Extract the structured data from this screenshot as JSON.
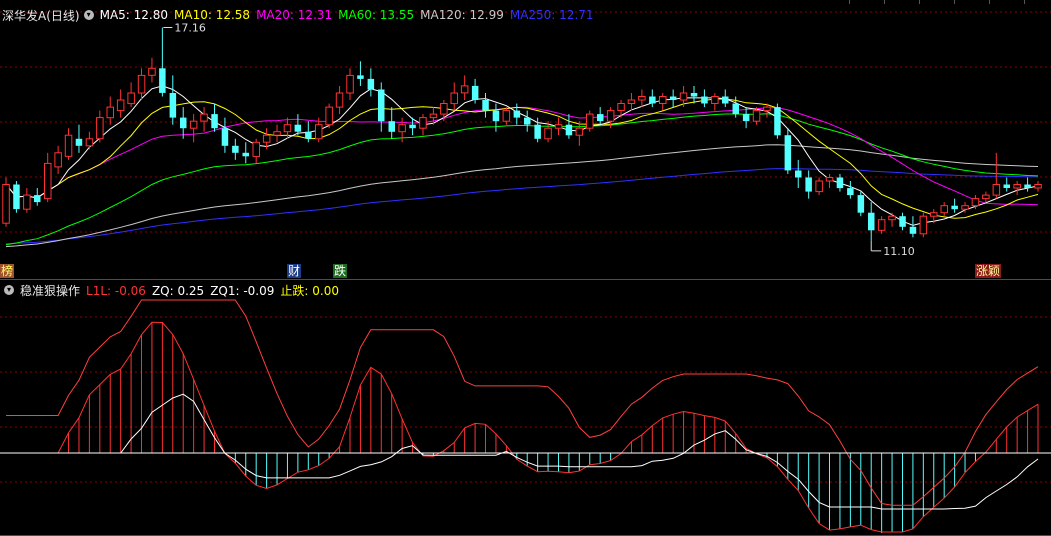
{
  "header": {
    "stock_name": "深华发A",
    "period": "(日线)",
    "ma": [
      {
        "label": "MA5: 12.80",
        "color": "#ffffff"
      },
      {
        "label": "MA10: 12.58",
        "color": "#ffff00"
      },
      {
        "label": "MA20: 12.31",
        "color": "#ff00ff"
      },
      {
        "label": "MA60: 13.55",
        "color": "#00ff00"
      },
      {
        "label": "MA120: 12.99",
        "color": "#c8c8c8"
      },
      {
        "label": "MA250: 12.71",
        "color": "#3030ff"
      }
    ]
  },
  "price_panel": {
    "high_label": "17.16",
    "low_label": "11.10",
    "tags": [
      {
        "text": "榜",
        "bg": "#a0522d",
        "color": "#ffff66"
      },
      {
        "text": "财",
        "bg": "#1e3a8a",
        "color": "#ffffff"
      },
      {
        "text": "跌",
        "bg": "#1f6b1f",
        "color": "#ffffff"
      },
      {
        "text": "涨颖",
        "bg": "#8b1a1a",
        "color": "#ffff99"
      }
    ]
  },
  "indicator": {
    "name": "稳准狠操作",
    "values": [
      {
        "label": "L1L: -0.06",
        "color": "#ff3333"
      },
      {
        "label": "ZQ: 0.25",
        "color": "#ffffff"
      },
      {
        "label": "ZQ1: -0.09",
        "color": "#ffffff"
      },
      {
        "label": "止跌: 0.00",
        "color": "#ffff00"
      }
    ]
  },
  "colors": {
    "up": "#ff3232",
    "down": "#54ffff",
    "grid": "#8b0000",
    "divider": "#b22222"
  },
  "candles": [
    [
      11.6,
      12.9,
      11.5,
      12.7
    ],
    [
      12.7,
      12.8,
      11.9,
      12.0
    ],
    [
      12.0,
      12.6,
      11.9,
      12.4
    ],
    [
      12.4,
      12.6,
      12.1,
      12.2
    ],
    [
      12.3,
      13.6,
      12.2,
      13.3
    ],
    [
      13.2,
      13.8,
      13.0,
      13.6
    ],
    [
      13.5,
      14.3,
      13.4,
      14.1
    ],
    [
      14.0,
      14.4,
      13.6,
      13.8
    ],
    [
      13.8,
      14.2,
      13.7,
      14.0
    ],
    [
      14.0,
      14.8,
      13.9,
      14.6
    ],
    [
      14.6,
      15.2,
      14.4,
      14.9
    ],
    [
      14.8,
      15.4,
      14.6,
      15.1
    ],
    [
      15.0,
      15.6,
      14.9,
      15.3
    ],
    [
      15.3,
      16.0,
      15.1,
      15.8
    ],
    [
      15.8,
      16.3,
      15.6,
      16.0
    ],
    [
      16.0,
      17.16,
      15.2,
      15.3
    ],
    [
      15.3,
      15.8,
      14.4,
      14.6
    ],
    [
      14.6,
      14.9,
      14.0,
      14.3
    ],
    [
      14.3,
      14.7,
      13.9,
      14.5
    ],
    [
      14.5,
      14.9,
      14.2,
      14.7
    ],
    [
      14.7,
      15.0,
      14.2,
      14.3
    ],
    [
      14.3,
      14.6,
      13.6,
      13.8
    ],
    [
      13.8,
      14.0,
      13.4,
      13.6
    ],
    [
      13.6,
      13.9,
      13.3,
      13.5
    ],
    [
      13.5,
      14.0,
      13.3,
      13.9
    ],
    [
      13.9,
      14.3,
      13.7,
      14.1
    ],
    [
      14.1,
      14.4,
      13.9,
      14.2
    ],
    [
      14.2,
      14.6,
      14.0,
      14.4
    ],
    [
      14.4,
      14.7,
      14.1,
      14.2
    ],
    [
      14.2,
      14.5,
      13.9,
      14.0
    ],
    [
      14.0,
      14.6,
      13.9,
      14.4
    ],
    [
      14.4,
      15.0,
      14.3,
      14.9
    ],
    [
      14.9,
      15.5,
      14.7,
      15.3
    ],
    [
      15.3,
      16.0,
      15.1,
      15.8
    ],
    [
      15.8,
      16.2,
      15.5,
      15.7
    ],
    [
      15.7,
      16.0,
      15.2,
      15.4
    ],
    [
      15.4,
      15.6,
      14.2,
      14.5
    ],
    [
      14.5,
      14.9,
      14.0,
      14.2
    ],
    [
      14.2,
      14.6,
      13.9,
      14.4
    ],
    [
      14.4,
      14.6,
      14.1,
      14.3
    ],
    [
      14.3,
      14.7,
      14.1,
      14.6
    ],
    [
      14.6,
      14.9,
      14.4,
      14.7
    ],
    [
      14.7,
      15.1,
      14.5,
      15.0
    ],
    [
      15.0,
      15.6,
      14.8,
      15.3
    ],
    [
      15.3,
      15.8,
      15.1,
      15.5
    ],
    [
      15.5,
      15.7,
      15.0,
      15.1
    ],
    [
      15.1,
      15.3,
      14.6,
      14.8
    ],
    [
      14.8,
      15.0,
      14.2,
      14.5
    ],
    [
      14.5,
      14.9,
      14.4,
      14.8
    ],
    [
      14.8,
      15.0,
      14.4,
      14.6
    ],
    [
      14.6,
      14.8,
      14.2,
      14.4
    ],
    [
      14.4,
      14.6,
      13.9,
      14.0
    ],
    [
      14.0,
      14.5,
      13.9,
      14.3
    ],
    [
      14.3,
      14.6,
      14.1,
      14.4
    ],
    [
      14.4,
      14.7,
      14.0,
      14.1
    ],
    [
      14.1,
      14.5,
      13.8,
      14.3
    ],
    [
      14.3,
      14.8,
      14.2,
      14.7
    ],
    [
      14.7,
      14.9,
      14.4,
      14.5
    ],
    [
      14.5,
      14.9,
      14.3,
      14.8
    ],
    [
      14.8,
      15.1,
      14.6,
      15.0
    ],
    [
      15.0,
      15.3,
      14.8,
      15.1
    ],
    [
      15.1,
      15.4,
      14.9,
      15.2
    ],
    [
      15.2,
      15.4,
      14.9,
      15.0
    ],
    [
      15.0,
      15.3,
      14.8,
      15.2
    ],
    [
      15.2,
      15.4,
      14.9,
      15.1
    ],
    [
      15.1,
      15.5,
      14.9,
      15.3
    ],
    [
      15.3,
      15.5,
      15.0,
      15.2
    ],
    [
      15.2,
      15.4,
      14.9,
      15.0
    ],
    [
      15.0,
      15.3,
      14.8,
      15.2
    ],
    [
      15.2,
      15.4,
      14.9,
      15.0
    ],
    [
      15.0,
      15.2,
      14.6,
      14.7
    ],
    [
      14.7,
      14.9,
      14.3,
      14.5
    ],
    [
      14.5,
      14.9,
      14.4,
      14.8
    ],
    [
      14.8,
      15.0,
      14.6,
      14.9
    ],
    [
      14.9,
      15.0,
      14.0,
      14.1
    ],
    [
      14.1,
      14.3,
      13.0,
      13.1
    ],
    [
      13.1,
      13.4,
      12.6,
      12.9
    ],
    [
      12.9,
      13.1,
      12.3,
      12.5
    ],
    [
      12.5,
      12.9,
      12.4,
      12.8
    ],
    [
      12.8,
      13.0,
      12.6,
      12.9
    ],
    [
      12.9,
      13.0,
      12.5,
      12.6
    ],
    [
      12.6,
      12.8,
      12.3,
      12.4
    ],
    [
      12.4,
      12.5,
      11.8,
      11.9
    ],
    [
      11.9,
      12.2,
      11.1,
      11.4
    ],
    [
      11.4,
      11.8,
      11.3,
      11.7
    ],
    [
      11.7,
      11.9,
      11.5,
      11.8
    ],
    [
      11.8,
      11.9,
      11.4,
      11.5
    ],
    [
      11.5,
      11.8,
      11.2,
      11.3
    ],
    [
      11.3,
      11.9,
      11.2,
      11.8
    ],
    [
      11.8,
      12.0,
      11.6,
      11.9
    ],
    [
      11.9,
      12.2,
      11.8,
      12.1
    ],
    [
      12.1,
      12.3,
      11.9,
      12.0
    ],
    [
      12.0,
      12.2,
      11.9,
      12.1
    ],
    [
      12.1,
      12.4,
      12.0,
      12.3
    ],
    [
      12.3,
      12.5,
      12.2,
      12.4
    ],
    [
      12.4,
      13.6,
      12.3,
      12.7
    ],
    [
      12.7,
      12.9,
      12.5,
      12.6
    ],
    [
      12.6,
      12.8,
      12.4,
      12.7
    ],
    [
      12.7,
      12.9,
      12.5,
      12.6
    ],
    [
      12.6,
      12.8,
      12.5,
      12.7
    ]
  ]
}
